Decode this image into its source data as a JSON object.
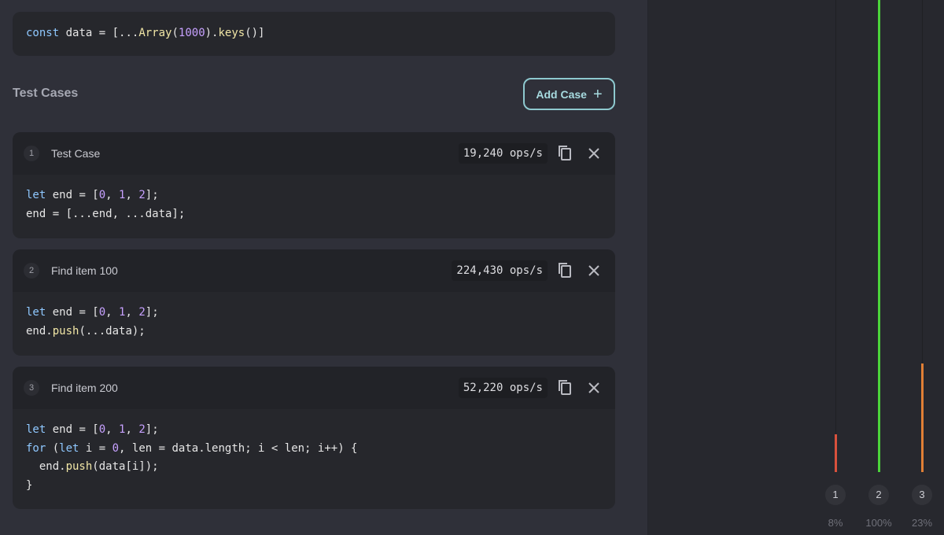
{
  "setup_code": "const data = [...Array(1000).keys()]",
  "section_title": "Test Cases",
  "add_button": {
    "label": "Add Case",
    "icon": "plus-icon"
  },
  "cases": [
    {
      "number": "1",
      "name": "Test Case",
      "ops": "19,240 ops/s",
      "code": [
        "let end = [0, 1, 2];",
        "end = [...end, ...data];"
      ]
    },
    {
      "number": "2",
      "name": "Find item 100",
      "ops": "224,430 ops/s",
      "code": [
        "let end = [0, 1, 2];",
        "end.push(...data);"
      ]
    },
    {
      "number": "3",
      "name": "Find item 200",
      "ops": "52,220 ops/s",
      "code": [
        "let end = [0, 1, 2];",
        "for (let i = 0, len = data.length; i < len; i++) {",
        "  end.push(data[i]);",
        "}"
      ]
    }
  ],
  "chart_data": {
    "type": "bar",
    "categories": [
      "1",
      "2",
      "3"
    ],
    "values": [
      8,
      100,
      23
    ],
    "labels": [
      "8%",
      "100%",
      "23%"
    ],
    "colors": [
      "#d9513c",
      "#4bd33a",
      "#e07f35"
    ],
    "ylim": [
      0,
      100
    ]
  },
  "colors": {
    "accent": "#8ec9cf",
    "background": "#2f3039",
    "card": "#26272c",
    "panel": "#27282e"
  }
}
